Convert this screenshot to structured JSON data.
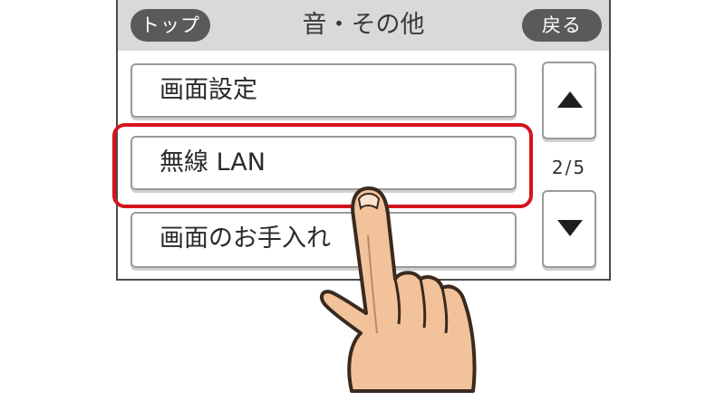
{
  "header": {
    "top_label": "トップ",
    "title": "音・その他",
    "back_label": "戻る"
  },
  "menu": {
    "items": [
      {
        "label": "画面設定"
      },
      {
        "label": "無線 LAN"
      },
      {
        "label": "画面のお手入れ"
      }
    ],
    "highlighted_item": "無線 LAN"
  },
  "pagination": {
    "indicator": "2/5",
    "current": 2,
    "total": 5
  },
  "icons": {
    "scroll_up": "triangle-up-icon",
    "scroll_down": "triangle-down-icon",
    "pointer": "hand-pointer-icon"
  },
  "colors": {
    "header_bg": "#d9d9d9",
    "pill_button": "#5a5a5a",
    "highlight": "#d5131e",
    "skin": "#f2c39b"
  }
}
